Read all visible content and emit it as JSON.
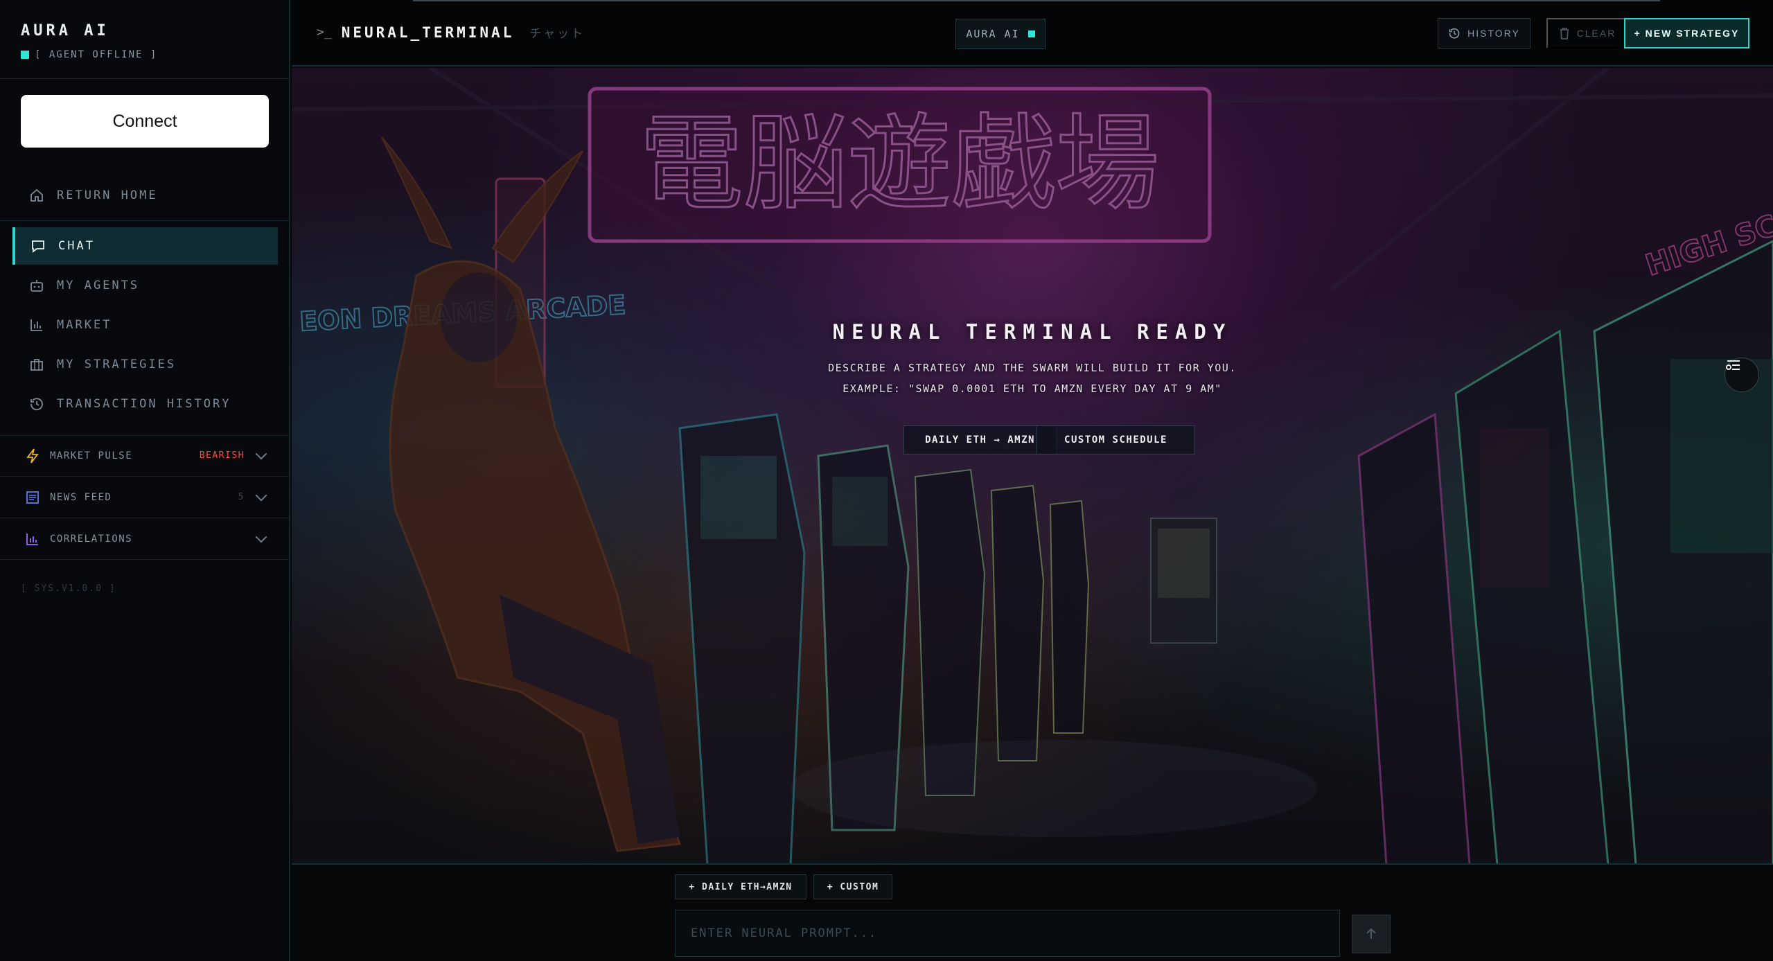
{
  "colors": {
    "accent": "#2ee6d6",
    "bearish": "#ff4d3d",
    "panel": "#07090c"
  },
  "sidebar": {
    "brand_title": "AURA AI",
    "status_text": "[ AGENT OFFLINE ]",
    "connect_label": "Connect",
    "nav": [
      {
        "label": "RETURN HOME",
        "icon": "home-icon"
      },
      {
        "label": "CHAT",
        "icon": "chat-icon",
        "active": true
      },
      {
        "label": "MY AGENTS",
        "icon": "robot-icon"
      },
      {
        "label": "MARKET",
        "icon": "bar-chart-icon"
      },
      {
        "label": "MY STRATEGIES",
        "icon": "briefcase-icon"
      },
      {
        "label": "TRANSACTION HISTORY",
        "icon": "history-icon"
      }
    ],
    "panels": [
      {
        "label": "MARKET PULSE",
        "badge": "BEARISH",
        "icon": "lightning-icon"
      },
      {
        "label": "NEWS FEED",
        "badge": "5",
        "icon": "newspaper-icon"
      },
      {
        "label": "CORRELATIONS",
        "badge": "",
        "icon": "chart-icon"
      }
    ],
    "version": "[ SYS.V1.0.0 ]"
  },
  "topbar": {
    "prompt": ">_",
    "title": "NEURAL_TERMINAL",
    "subtitle": "チャット",
    "agent_label": "AURA AI",
    "history_label": "HISTORY",
    "clear_label": "CLEAR",
    "new_strategy_label": "+ NEW STRATEGY"
  },
  "hero": {
    "title": "NEURAL TERMINAL READY",
    "description": "DESCRIBE A STRATEGY AND THE SWARM WILL BUILD IT FOR YOU.",
    "example": "EXAMPLE: \"SWAP 0.0001 ETH TO AMZN EVERY DAY AT 9 AM\"",
    "chips": [
      "DAILY ETH → AMZN",
      "CUSTOM SCHEDULE"
    ],
    "sign_text": "電脳遊戯場",
    "neon_left": "EON DREAMS ARCADE",
    "neon_right": "HIGH SCORE"
  },
  "composer": {
    "quick_actions": [
      "+ DAILY ETH→AMZN",
      "+ CUSTOM"
    ],
    "placeholder": "ENTER NEURAL PROMPT..."
  }
}
